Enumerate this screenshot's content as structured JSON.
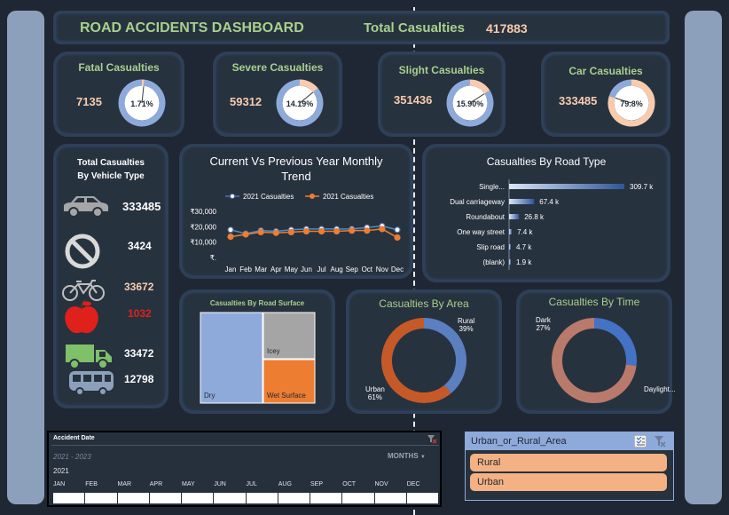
{
  "header": {
    "title": "ROAD ACCIDENTS DASHBOARD",
    "total_label": "Total Casualties",
    "total_value": "417883"
  },
  "kpis": [
    {
      "label": "Fatal Casualties",
      "value": "7135",
      "pct": "1.71%",
      "fraction": 0.0171
    },
    {
      "label": "Severe Casualties",
      "value": "59312",
      "pct": "14.19%",
      "fraction": 0.1419
    },
    {
      "label": "Slight Casualties",
      "value": "351436",
      "pct": "15.90%",
      "fraction": 0.159
    },
    {
      "label": "Car Casualties",
      "value": "333485",
      "pct": "79.8%",
      "fraction": 0.798
    }
  ],
  "vehicles": {
    "title_line1": "Total Casualties",
    "title_line2": "By Vehicle Type",
    "items": [
      {
        "icon": "car-icon",
        "value": "333485",
        "color": "#8da0bb"
      },
      {
        "icon": "prohibited-icon",
        "value": "3424",
        "color": "#ffffff"
      },
      {
        "icon": "bicycle-icon",
        "value": "33672",
        "color": "#f8cbad"
      },
      {
        "icon": "apple-icon",
        "value": "1032",
        "color": "#e0201b"
      },
      {
        "icon": "truck-icon",
        "value": "33472",
        "color": "#ffffff"
      },
      {
        "icon": "bus-icon",
        "value": "12798",
        "color": "#ffffff"
      }
    ]
  },
  "trend": {
    "title_line1": "Current Vs Previous Year Monthly",
    "title_line2": "Trend",
    "legend": [
      "2021 Casualties",
      "2021 Casualties"
    ]
  },
  "road_type": {
    "title": "Casualties By Road Type"
  },
  "road_surface": {
    "title": "Casualties By Road Surface"
  },
  "area": {
    "title": "Casualties By Area",
    "labels": [
      {
        "name": "Rural",
        "pct": "39%"
      },
      {
        "name": "Urban",
        "pct": "61%"
      }
    ]
  },
  "time": {
    "title": "Casualties By Time",
    "labels": [
      {
        "name": "Dark",
        "pct": "27%"
      },
      {
        "name": "Daylight..."
      }
    ]
  },
  "timeline": {
    "title": "Accident Date",
    "range": "2021 - 2023",
    "level": "MONTHS",
    "year": "2021",
    "months": [
      "JAN",
      "FEB",
      "MAR",
      "APR",
      "MAY",
      "JUN",
      "JUL",
      "AUG",
      "SEP",
      "OCT",
      "NOV",
      "DEC"
    ]
  },
  "slicer": {
    "title": "Urban_or_Rural_Area",
    "items": [
      "Rural",
      "Urban"
    ]
  },
  "chart_data": [
    {
      "type": "line",
      "title": "Current Vs Previous Year Monthly Trend",
      "categories": [
        "Jan",
        "Feb",
        "Mar",
        "Apr",
        "May",
        "Jun",
        "Jul",
        "Aug",
        "Sep",
        "Oct",
        "Nov",
        "Dec"
      ],
      "y_ticks": [
        "₹.",
        "₹10,000",
        "₹20,000",
        "₹30,000"
      ],
      "ylim": [
        0,
        30000
      ],
      "series": [
        {
          "name": "2021 Casualties",
          "color": "#4e6fa8",
          "values": [
            18000,
            15500,
            17500,
            17000,
            18000,
            18500,
            18500,
            18500,
            18500,
            19500,
            20500,
            18000
          ]
        },
        {
          "name": "2021 Casualties",
          "color": "#ed7d31",
          "values": [
            13500,
            15000,
            16500,
            16000,
            16500,
            17000,
            17000,
            17000,
            17500,
            17500,
            18500,
            13000
          ]
        }
      ]
    },
    {
      "type": "bar",
      "title": "Casualties By Road Type",
      "categories": [
        "Single...",
        "Dual carriageway",
        "Roundabout",
        "One way street",
        "Slip road",
        "(blank)"
      ],
      "values": [
        309.7,
        67.4,
        26.8,
        7.4,
        4.7,
        1.9
      ],
      "labels": [
        "309.7 k",
        "67.4 k",
        "26.8 k",
        "7.4 k",
        "4.7 k",
        "1.9 k"
      ]
    },
    {
      "type": "treemap",
      "title": "Casualties By Road Surface",
      "categories": [
        "Dry",
        "Icey",
        "Wet Surface"
      ],
      "colors": [
        "#8eaadb",
        "#a5a5a5",
        "#ed7d31"
      ]
    },
    {
      "type": "pie",
      "title": "Casualties By Area",
      "categories": [
        "Rural",
        "Urban"
      ],
      "values": [
        39,
        61
      ]
    },
    {
      "type": "pie",
      "title": "Casualties By Time",
      "categories": [
        "Dark",
        "Daylight..."
      ],
      "values": [
        27,
        73
      ]
    }
  ]
}
